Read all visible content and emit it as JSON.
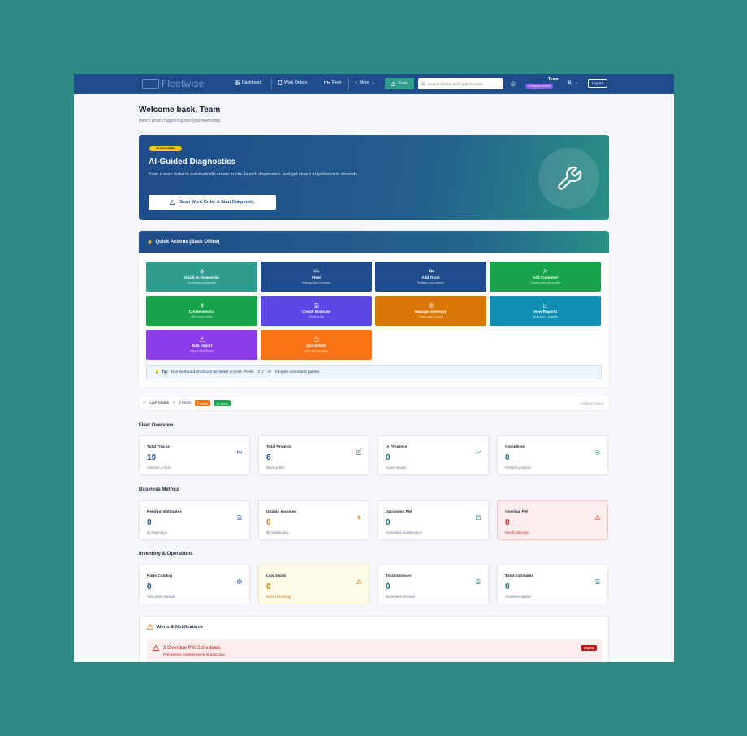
{
  "nav": {
    "logo_text": "Fleetwise",
    "items": [
      {
        "label": "Dashboard",
        "icon": "grid-icon"
      },
      {
        "label": "Work Orders",
        "icon": "document-icon"
      },
      {
        "label": "Fleet",
        "icon": "truck-icon"
      },
      {
        "label": "More",
        "icon": "plus-icon"
      }
    ],
    "scan_label": "Scan",
    "search_placeholder": "Search trucks, work orders, custo",
    "user_name": "Team",
    "role": "Company Admin",
    "logout_label": "Logout"
  },
  "welcome": {
    "title": "Welcome back, Team",
    "subtitle": "Here's what's happening with your fleet today."
  },
  "hero": {
    "badge": "START HERE",
    "title": "AI-Guided Diagnostics",
    "description": "Scan a work order to automatically create trucks, launch diagnostics, and get expert AI guidance in seconds.",
    "button": "Scan Work Order & Start Diagnostic"
  },
  "quick_actions": {
    "title": "Quick Actions (Back Office)",
    "tiles": [
      {
        "label": "Quick AI Diagnostic",
        "sub": "AI-powered diagnosis",
        "color": "#2f9c8e",
        "icon": "sparkle-icon"
      },
      {
        "label": "Fleet",
        "sub": "Manage fleet vehicles",
        "color": "#1f4c8a",
        "icon": "truck-icon"
      },
      {
        "label": "Add Truck",
        "sub": "Register new vehicle",
        "color": "#1f4c8a",
        "icon": "truck-icon"
      },
      {
        "label": "Add Customer",
        "sub": "Create customer profile",
        "color": "#16a34a",
        "icon": "users-icon"
      },
      {
        "label": "Create Invoice",
        "sub": "Bill a work order",
        "color": "#16a34a",
        "icon": "dollar-icon"
      },
      {
        "label": "Create Estimate",
        "sub": "Quote a job",
        "color": "#5b46e6",
        "icon": "file-icon"
      },
      {
        "label": "Manage Inventory",
        "sub": "Track parts & stock",
        "color": "#d97706",
        "icon": "box-icon"
      },
      {
        "label": "View Reports",
        "sub": "Analytics & insights",
        "color": "#0e8fb2",
        "icon": "chart-icon"
      },
      {
        "label": "Bulk Import",
        "sub": "Import from Excel",
        "color": "#8b3dea",
        "icon": "upload-icon"
      },
      {
        "label": "Quick Note",
        "sub": "Add notes to truck",
        "color": "#f97316",
        "icon": "note-icon"
      }
    ],
    "tip_label": "Tip:",
    "tip_text": "Use keyboard shortcuts for faster access. Press",
    "tip_key": "Ctrl+K",
    "tip_end": "to open command palette."
  },
  "live": {
    "label": "Live Status",
    "techs": "3 techs",
    "active": "0 active",
    "done": "12 done",
    "updated": "Updated 0s ago"
  },
  "fleet_overview": {
    "title": "Fleet Overview",
    "cards": [
      {
        "label": "Total Trucks",
        "value": "19",
        "sub": "Vehicles in fleet",
        "color": "#1f4c8a",
        "icon": "truck-icon"
      },
      {
        "label": "Total Projects",
        "value": "8",
        "sub": "Work orders",
        "color": "#1f4c8a",
        "icon": "clipboard-icon"
      },
      {
        "label": "In Progress",
        "value": "0",
        "sub": "Active repairs",
        "color": "#0f766e",
        "icon": "trend-icon"
      },
      {
        "label": "Completed",
        "value": "0",
        "sub": "Finished projects",
        "color": "#0f766e",
        "icon": "check-circle-icon"
      }
    ]
  },
  "business_metrics": {
    "title": "Business Metrics",
    "cards": [
      {
        "label": "Pending Estimates",
        "value": "0",
        "sub": "$0 total value",
        "color": "#1f4c8a",
        "icon": "file-icon"
      },
      {
        "label": "Unpaid Invoices",
        "value": "0",
        "sub": "$0 outstanding",
        "color": "#d97706",
        "icon": "dollar-icon"
      },
      {
        "label": "Upcoming PM",
        "value": "0",
        "sub": "Scheduled maintenance",
        "color": "#0f766e",
        "icon": "calendar-icon"
      },
      {
        "label": "Overdue PM",
        "value": "0",
        "sub": "Needs attention",
        "color": "#dc2626",
        "icon": "warning-icon"
      }
    ]
  },
  "inventory": {
    "title": "Inventory & Operations",
    "cards": [
      {
        "label": "Parts Catalog",
        "value": "0",
        "sub": "Total parts tracked",
        "color": "#1f4c8a",
        "icon": "globe-icon"
      },
      {
        "label": "Low Stock",
        "value": "0",
        "sub": "Need reordering",
        "color": "#d97706",
        "icon": "warning-icon"
      },
      {
        "label": "Total Invoices",
        "value": "0",
        "sub": "Generated invoices",
        "color": "#0f766e",
        "icon": "file-icon"
      },
      {
        "label": "Total Estimates",
        "value": "0",
        "sub": "Customer quotes",
        "color": "#0f766e",
        "icon": "file-icon"
      }
    ]
  },
  "alerts": {
    "title": "Alerts & Notifications",
    "items": [
      {
        "title": "3 Overdue PM Schedules",
        "desc": "Preventive maintenance is past due",
        "badge": "Urgent"
      }
    ]
  },
  "colors": {
    "nav": "#1f4c8a",
    "teal": "#2f9c8e",
    "background": "#2e8b84"
  }
}
